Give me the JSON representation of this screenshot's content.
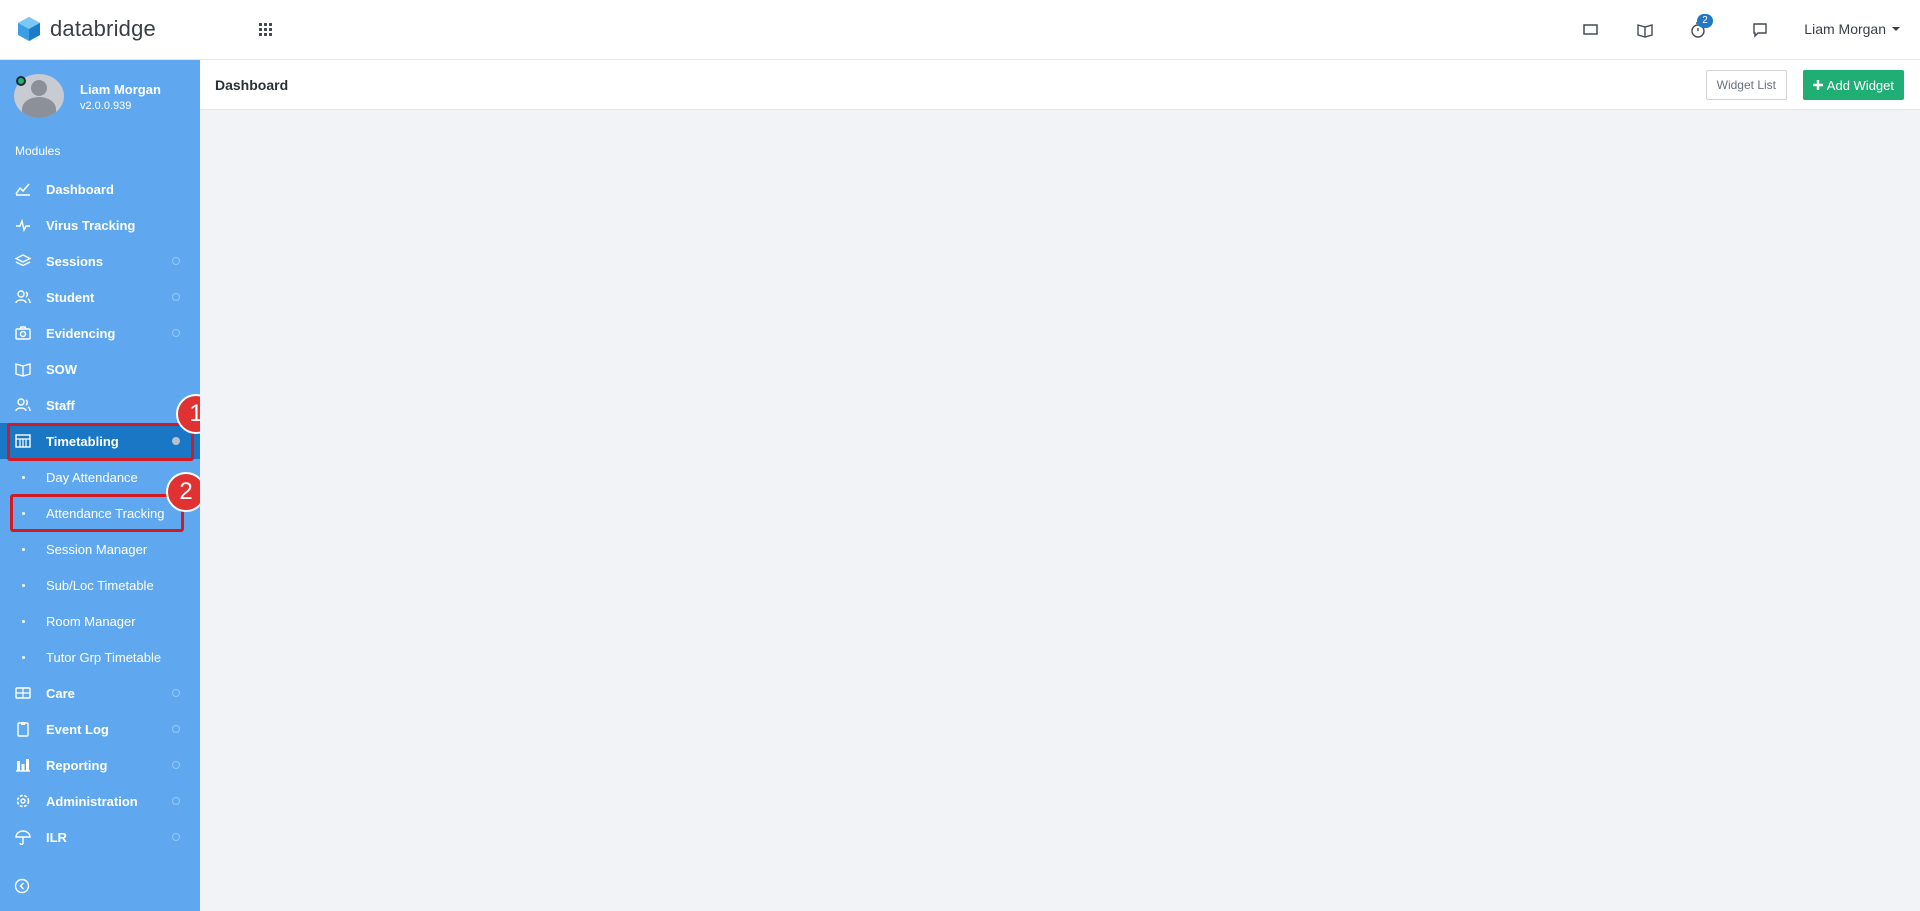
{
  "brand": {
    "name": "databridge"
  },
  "topbar": {
    "notification_count": "2",
    "user_name": "Liam Morgan"
  },
  "sidebar": {
    "profile_name": "Liam Morgan",
    "version": "v2.0.0.939",
    "section_label": "Modules",
    "items": [
      {
        "label": "Dashboard",
        "icon": "chart-line-icon"
      },
      {
        "label": "Virus Tracking",
        "icon": "pulse-icon"
      },
      {
        "label": "Sessions",
        "icon": "layers-icon"
      },
      {
        "label": "Student",
        "icon": "users-icon"
      },
      {
        "label": "Evidencing",
        "icon": "camera-icon"
      },
      {
        "label": "SOW",
        "icon": "book-icon"
      },
      {
        "label": "Staff",
        "icon": "users-icon"
      },
      {
        "label": "Timetabling",
        "icon": "calendar-icon"
      }
    ],
    "subitems": [
      "Day Attendance",
      "Attendance Tracking",
      "Session Manager",
      "Sub/Loc Timetable",
      "Room Manager",
      "Tutor Grp Timetable"
    ],
    "items_after": [
      {
        "label": "Care",
        "icon": "care-icon"
      },
      {
        "label": "Event Log",
        "icon": "clipboard-icon"
      },
      {
        "label": "Reporting",
        "icon": "bar-chart-icon"
      },
      {
        "label": "Administration",
        "icon": "gear-icon"
      },
      {
        "label": "ILR",
        "icon": "umbrella-icon"
      }
    ]
  },
  "annotations": {
    "one": "1",
    "two": "2",
    "color": "#d11a22"
  },
  "content": {
    "title": "Dashboard",
    "widget_list_label": "Widget List",
    "add_widget_label": "Add Widget"
  },
  "colors": {
    "sidebar": "#5fa8f0",
    "active": "#1a77c5",
    "accent_green": "#1fae74"
  }
}
